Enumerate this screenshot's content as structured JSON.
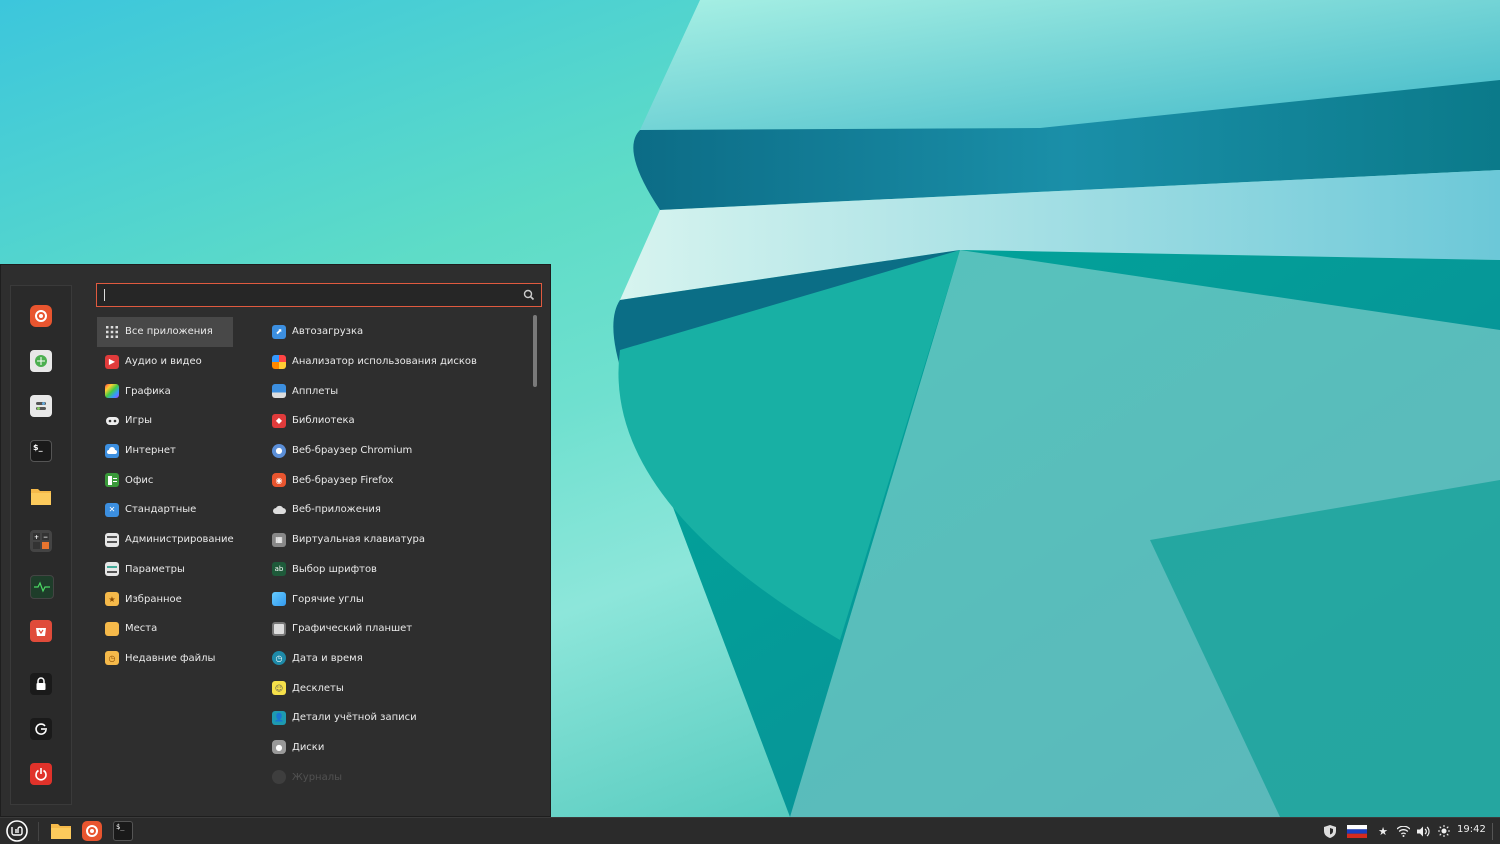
{
  "search": {
    "value": "",
    "placeholder": ""
  },
  "favorites": [
    {
      "icon": "firefox-icon"
    },
    {
      "icon": "software-manager-icon"
    },
    {
      "icon": "system-settings-icon"
    },
    {
      "icon": "terminal-icon"
    },
    {
      "icon": "files-icon"
    },
    {
      "icon": "calculator-icon"
    },
    {
      "icon": "system-monitor-icon"
    },
    {
      "icon": "update-manager-icon"
    },
    {
      "icon": "lock-screen-icon"
    },
    {
      "icon": "logout-icon"
    },
    {
      "icon": "power-icon"
    }
  ],
  "categories": [
    {
      "label": "Все приложения",
      "icon": "grid-icon",
      "active": true
    },
    {
      "label": "Аудио и видео",
      "icon": "media-icon"
    },
    {
      "label": "Графика",
      "icon": "graphics-icon"
    },
    {
      "label": "Игры",
      "icon": "gamepad-icon"
    },
    {
      "label": "Интернет",
      "icon": "cloud-icon"
    },
    {
      "label": "Офис",
      "icon": "office-icon"
    },
    {
      "label": "Стандартные",
      "icon": "accessories-icon"
    },
    {
      "label": "Администрирование",
      "icon": "admin-icon"
    },
    {
      "label": "Параметры",
      "icon": "preferences-icon"
    },
    {
      "label": "Избранное",
      "icon": "favorites-folder-icon"
    },
    {
      "label": "Места",
      "icon": "places-folder-icon"
    },
    {
      "label": "Недавние файлы",
      "icon": "recent-folder-icon"
    }
  ],
  "apps": [
    {
      "label": "Автозагрузка",
      "icon": "startup-icon"
    },
    {
      "label": "Анализатор использования дисков",
      "icon": "disk-usage-icon"
    },
    {
      "label": "Апплеты",
      "icon": "applets-icon"
    },
    {
      "label": "Библиотека",
      "icon": "library-icon"
    },
    {
      "label": "Веб-браузер Chromium",
      "icon": "chromium-icon"
    },
    {
      "label": "Веб-браузер Firefox",
      "icon": "firefox-icon"
    },
    {
      "label": "Веб-приложения",
      "icon": "webapps-icon"
    },
    {
      "label": "Виртуальная клавиатура",
      "icon": "keyboard-icon"
    },
    {
      "label": "Выбор шрифтов",
      "icon": "fonts-icon"
    },
    {
      "label": "Горячие углы",
      "icon": "hot-corners-icon"
    },
    {
      "label": "Графический планшет",
      "icon": "tablet-icon"
    },
    {
      "label": "Дата и время",
      "icon": "clock-icon"
    },
    {
      "label": "Десклеты",
      "icon": "desklets-icon"
    },
    {
      "label": "Детали учётной записи",
      "icon": "account-icon"
    },
    {
      "label": "Диски",
      "icon": "disks-icon"
    },
    {
      "label": "Журналы",
      "icon": "logs-icon",
      "faded": true
    }
  ],
  "panel": {
    "time": "19:42",
    "launchers": [
      "files-icon",
      "firefox-icon",
      "terminal-icon"
    ],
    "tray": [
      "shield-icon",
      "russian-flag-icon",
      "star-icon",
      "wifi-icon",
      "volume-icon",
      "brightness-icon"
    ]
  },
  "colors": {
    "accent": "#e05a3f",
    "menu_bg": "#2e2e2e",
    "panel_bg": "#2b2b2b"
  }
}
